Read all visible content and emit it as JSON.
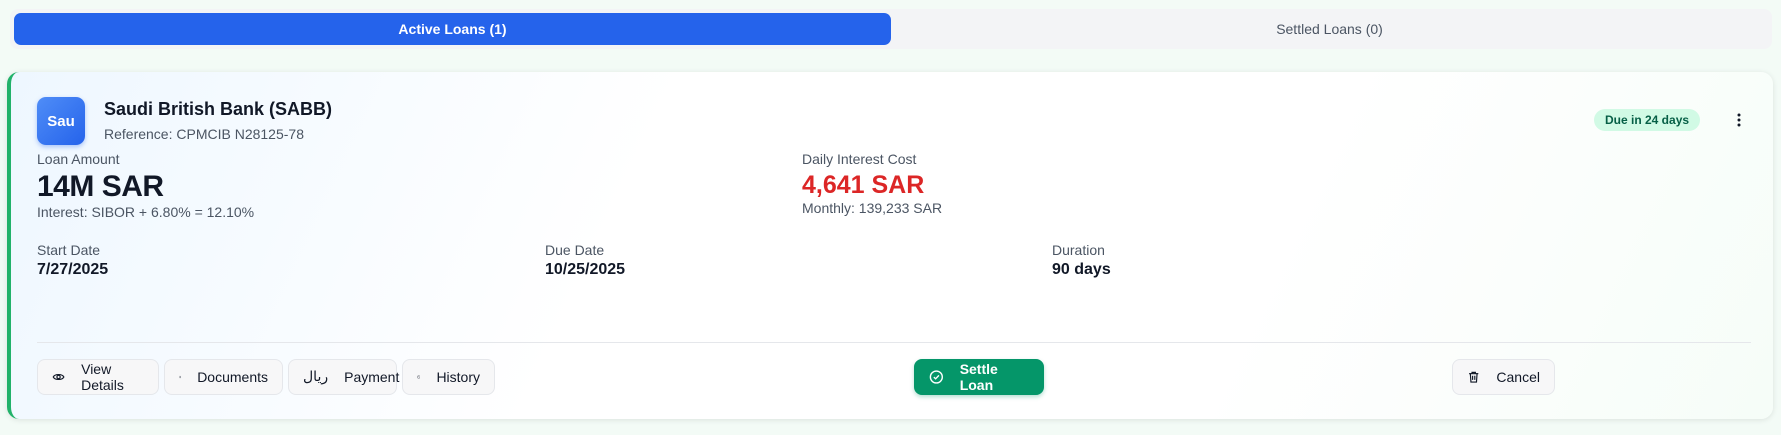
{
  "tabs": [
    {
      "label": "Active Loans (1)",
      "active": true
    },
    {
      "label": "Settled Loans (0)",
      "active": false
    }
  ],
  "loan": {
    "bank_initials": "Sau",
    "bank_name": "Saudi British Bank (SABB)",
    "reference": "Reference: CPMCIB N28125-78",
    "due_badge": "Due in 24 days",
    "loan_amount_label": "Loan Amount",
    "loan_amount": "14M SAR",
    "interest": "Interest: SIBOR + 6.80% = 12.10%",
    "daily_interest_label": "Daily Interest Cost",
    "daily_interest": "4,641 SAR",
    "monthly": "Monthly: 139,233 SAR",
    "start_date_label": "Start Date",
    "start_date": "7/27/2025",
    "due_date_label": "Due Date",
    "due_date": "10/25/2025",
    "duration_label": "Duration",
    "duration": "90 days"
  },
  "actions": {
    "view_details": "View Details",
    "documents": "Documents",
    "payment_icon_glyph": "ريال",
    "payment": "Payment",
    "history": "History",
    "settle": "Settle Loan",
    "cancel": "Cancel"
  },
  "icons": [
    "eye-icon",
    "document-icon",
    "riyal-icon",
    "clock-icon",
    "check-circle-icon",
    "trash-icon",
    "more-vertical-icon"
  ],
  "colors": {
    "accent": "#2563eb",
    "success": "#059669",
    "danger": "#dc2626",
    "badge_bg": "#d1fae5",
    "card_border": "#22b26a"
  }
}
